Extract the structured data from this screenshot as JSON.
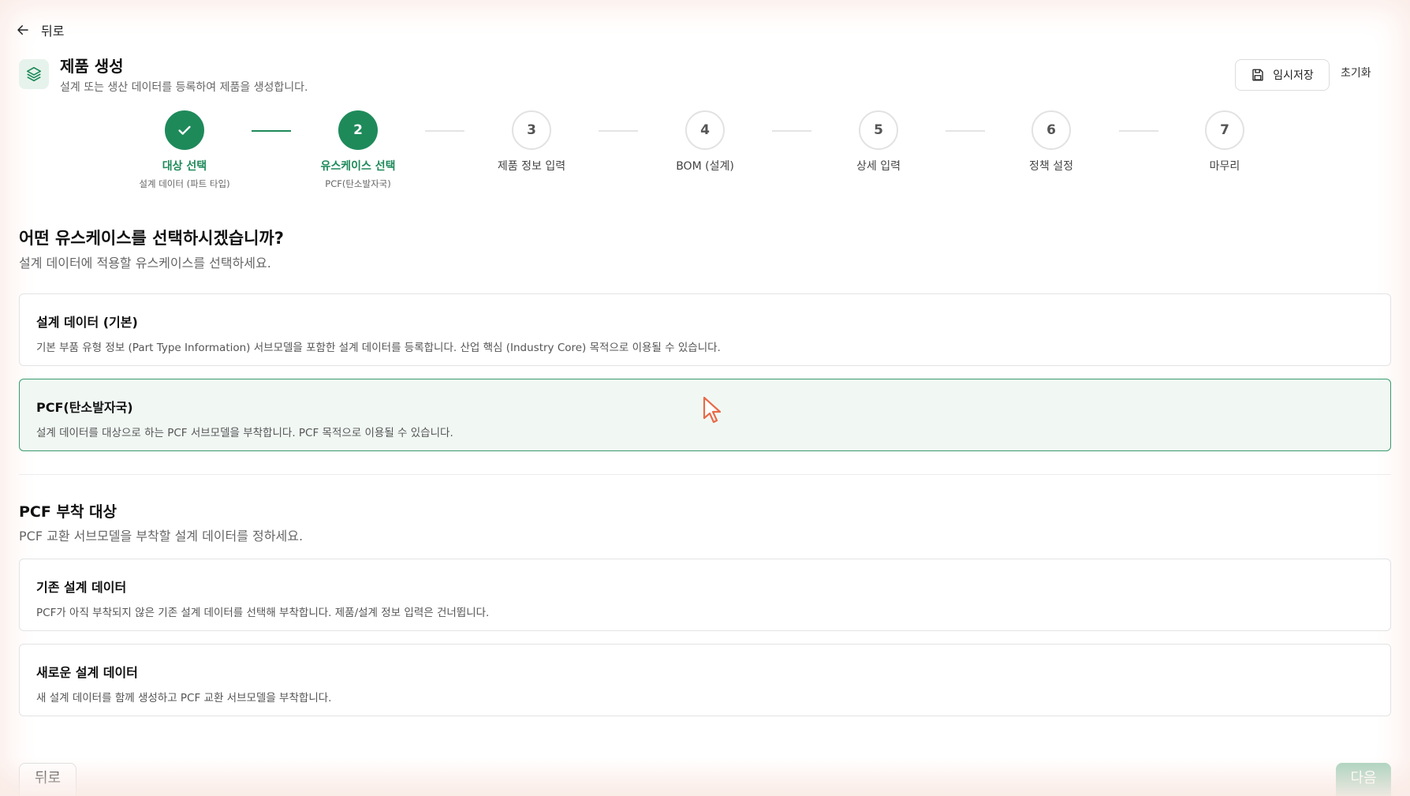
{
  "nav": {
    "back_label": "뒤로"
  },
  "header": {
    "title": "제품 생성",
    "subtitle": "설계 또는 생산 데이터를 등록하여 제품을 생성합니다.",
    "draft_label": "임시저장",
    "reset_label": "초기화"
  },
  "steps": [
    {
      "number": "",
      "label": "대상 선택",
      "sub": "설계 데이터 (파트 타입)",
      "state": "done"
    },
    {
      "number": "2",
      "label": "유스케이스 선택",
      "sub": "PCF(탄소발자국)",
      "state": "active"
    },
    {
      "number": "3",
      "label": "제품 정보 입력",
      "sub": "",
      "state": "pending"
    },
    {
      "number": "4",
      "label": "BOM (설계)",
      "sub": "",
      "state": "pending"
    },
    {
      "number": "5",
      "label": "상세 입력",
      "sub": "",
      "state": "pending"
    },
    {
      "number": "6",
      "label": "정책 설정",
      "sub": "",
      "state": "pending"
    },
    {
      "number": "7",
      "label": "마무리",
      "sub": "",
      "state": "pending"
    }
  ],
  "usecase": {
    "title": "어떤 유스케이스를 선택하시겠습니까?",
    "desc": "설계 데이터에 적용할 유스케이스를 선택하세요.",
    "options": [
      {
        "title": "설계 데이터 (기본)",
        "desc": "기본 부품 유형 정보 (Part Type Information) 서브모델을 포함한 설계 데이터를 등록합니다. 산업 핵심 (Industry Core) 목적으로 이용될 수 있습니다.",
        "selected": false
      },
      {
        "title": "PCF(탄소발자국)",
        "desc": "설계 데이터를 대상으로 하는 PCF 서브모델을 부착합니다. PCF 목적으로 이용될 수 있습니다.",
        "selected": true
      }
    ]
  },
  "pcf_target": {
    "title": "PCF 부착 대상",
    "desc": "PCF 교환 서브모델을 부착할 설계 데이터를 정하세요.",
    "options": [
      {
        "title": "기존 설계 데이터",
        "desc": "PCF가 아직 부착되지 않은 기존 설계 데이터를 선택해 부착합니다. 제품/설계 정보 입력은 건너뜁니다."
      },
      {
        "title": "새로운 설계 데이터",
        "desc": "새 설계 데이터를 함께 생성하고 PCF 교환 서브모델을 부착합니다."
      }
    ]
  },
  "footer": {
    "prev_label": "뒤로",
    "next_label": "다음"
  },
  "colors": {
    "accent": "#1e8a5a",
    "accent_light": "#f1f8f4",
    "disabled_next": "#a6d1bb"
  },
  "icons": {
    "back": "arrow-left-icon",
    "logo": "layers-icon",
    "draft": "save-icon",
    "done_step": "check-icon",
    "cursor": "mouse-cursor-icon"
  }
}
